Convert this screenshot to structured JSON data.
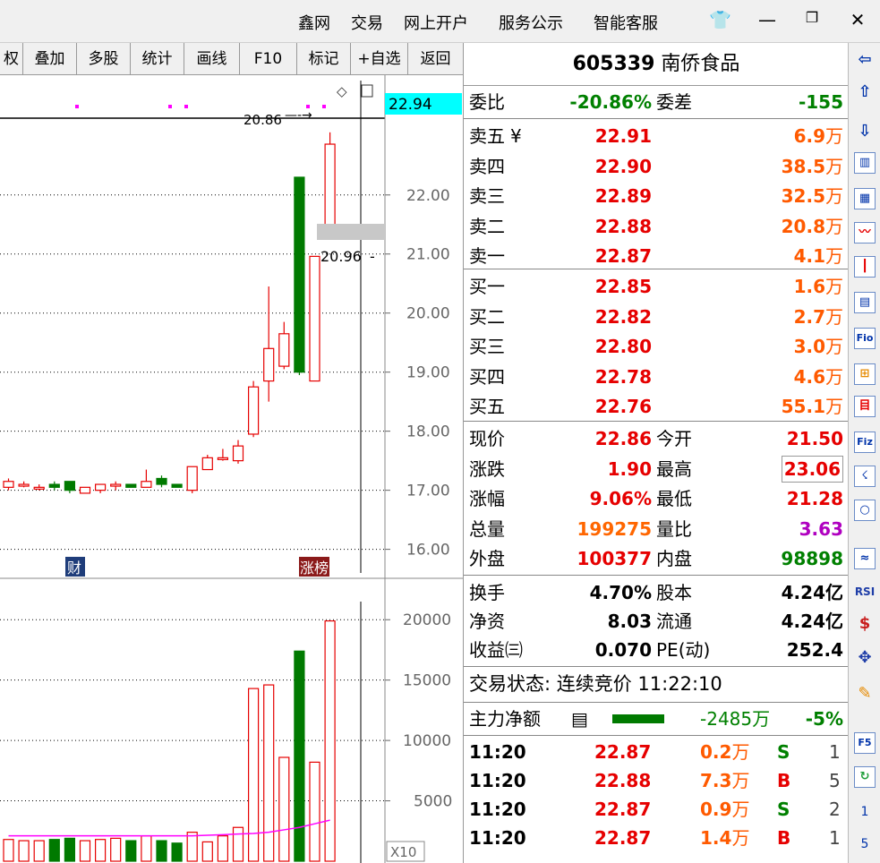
{
  "topbar": {
    "menus": [
      "鑫网",
      "交易",
      "网上开户",
      "服务公示",
      "智能客服"
    ]
  },
  "toolbar": {
    "buttons": [
      "权",
      "叠加",
      "多股",
      "统计",
      "画线",
      "F10",
      "标记",
      "+自选",
      "返回"
    ]
  },
  "chart": {
    "price_ticks": [
      "22.00",
      "21.00",
      "20.00",
      "19.00",
      "18.00",
      "17.00",
      "16.00"
    ],
    "volume_ticks": [
      "20000",
      "15000",
      "10000",
      "5000"
    ],
    "current_price_tag": "22.94",
    "annotation_high": "20.86",
    "annotation_mid": "20.96",
    "tag_cai": "财",
    "tag_zhangbang": "涨榜",
    "vol_unit": "X10"
  },
  "quote": {
    "code": "605339",
    "name": "南侨食品",
    "weibi": {
      "label": "委比",
      "value": "-20.86%",
      "label2": "委差",
      "value2": "-155"
    },
    "asks": [
      {
        "label": "卖五",
        "mark": "¥",
        "price": "22.91",
        "vol": "6.9",
        "unit": "万"
      },
      {
        "label": "卖四",
        "mark": "",
        "price": "22.90",
        "vol": "38.5",
        "unit": "万"
      },
      {
        "label": "卖三",
        "mark": "",
        "price": "22.89",
        "vol": "32.5",
        "unit": "万"
      },
      {
        "label": "卖二",
        "mark": "",
        "price": "22.88",
        "vol": "20.8",
        "unit": "万"
      },
      {
        "label": "卖一",
        "mark": "",
        "price": "22.87",
        "vol": "4.1",
        "unit": "万"
      }
    ],
    "bids": [
      {
        "label": "买一",
        "price": "22.85",
        "vol": "1.6",
        "unit": "万"
      },
      {
        "label": "买二",
        "price": "22.82",
        "vol": "2.7",
        "unit": "万"
      },
      {
        "label": "买三",
        "price": "22.80",
        "vol": "3.0",
        "unit": "万"
      },
      {
        "label": "买四",
        "price": "22.78",
        "vol": "4.6",
        "unit": "万"
      },
      {
        "label": "买五",
        "price": "22.76",
        "vol": "55.1",
        "unit": "万"
      }
    ],
    "stats": [
      {
        "l1": "现价",
        "v1": "22.86",
        "c1": "red",
        "l2": "今开",
        "v2": "21.50",
        "c2": "red"
      },
      {
        "l1": "涨跌",
        "v1": "1.90",
        "c1": "red",
        "l2": "最高",
        "v2": "23.06",
        "c2": "red"
      },
      {
        "l1": "涨幅",
        "v1": "9.06%",
        "c1": "red",
        "l2": "最低",
        "v2": "21.28",
        "c2": "red"
      },
      {
        "l1": "总量",
        "v1": "199275",
        "c1": "orange",
        "l2": "量比",
        "v2": "3.63",
        "c2": "purple"
      },
      {
        "l1": "外盘",
        "v1": "100377",
        "c1": "red",
        "l2": "内盘",
        "v2": "98898",
        "c2": "green"
      }
    ],
    "fund": [
      {
        "l1": "换手",
        "v1": "4.70%",
        "l2": "股本",
        "v2": "4.24亿"
      },
      {
        "l1": "净资",
        "v1": "8.03",
        "l2": "流通",
        "v2": "4.24亿"
      },
      {
        "l1": "收益㈢",
        "v1": "0.070",
        "l2": "PE(动)",
        "v2": "252.4"
      }
    ],
    "status": "交易状态: 连续竞价 11:22:10",
    "mainflow": {
      "label": "主力净额",
      "value": "-2485",
      "unit": "万",
      "pct": "-5%"
    },
    "trades": [
      {
        "time": "11:20",
        "price": "22.87",
        "vol": "0.2",
        "unit": "万",
        "side": "S",
        "n": "1"
      },
      {
        "time": "11:20",
        "price": "22.88",
        "vol": "7.3",
        "unit": "万",
        "side": "B",
        "n": "5"
      },
      {
        "time": "11:20",
        "price": "22.87",
        "vol": "0.9",
        "unit": "万",
        "side": "S",
        "n": "2"
      },
      {
        "time": "11:20",
        "price": "22.87",
        "vol": "1.4",
        "unit": "万",
        "side": "B",
        "n": "1"
      }
    ]
  },
  "sidebar": {
    "labels": [
      "Fio",
      "Fiz",
      "RSI",
      "F5",
      "1",
      "5"
    ]
  },
  "chart_data": {
    "type": "candlestick",
    "ylim": [
      15.6,
      23.3
    ],
    "candles": [
      {
        "o": 17.05,
        "c": 17.15,
        "h": 17.2,
        "l": 17.0
      },
      {
        "o": 17.1,
        "c": 17.1,
        "h": 17.15,
        "l": 17.05
      },
      {
        "o": 17.05,
        "c": 17.05,
        "h": 17.1,
        "l": 17.0
      },
      {
        "o": 17.1,
        "c": 17.05,
        "h": 17.15,
        "l": 17.0
      },
      {
        "o": 17.15,
        "c": 17.0,
        "h": 17.15,
        "l": 16.95
      },
      {
        "o": 16.95,
        "c": 17.05,
        "h": 17.05,
        "l": 16.95
      },
      {
        "o": 17.0,
        "c": 17.1,
        "h": 17.1,
        "l": 16.95
      },
      {
        "o": 17.1,
        "c": 17.1,
        "h": 17.15,
        "l": 17.0
      },
      {
        "o": 17.1,
        "c": 17.05,
        "h": 17.1,
        "l": 17.05
      },
      {
        "o": 17.05,
        "c": 17.15,
        "h": 17.35,
        "l": 17.05
      },
      {
        "o": 17.2,
        "c": 17.1,
        "h": 17.25,
        "l": 17.05
      },
      {
        "o": 17.1,
        "c": 17.05,
        "h": 17.1,
        "l": 17.05
      },
      {
        "o": 17.0,
        "c": 17.4,
        "h": 17.4,
        "l": 16.95
      },
      {
        "o": 17.35,
        "c": 17.55,
        "h": 17.6,
        "l": 17.35
      },
      {
        "o": 17.55,
        "c": 17.55,
        "h": 17.7,
        "l": 17.5
      },
      {
        "o": 17.5,
        "c": 17.75,
        "h": 17.85,
        "l": 17.45
      },
      {
        "o": 17.95,
        "c": 18.75,
        "h": 18.85,
        "l": 17.9
      },
      {
        "o": 18.85,
        "c": 19.4,
        "h": 20.45,
        "l": 18.5
      },
      {
        "o": 19.1,
        "c": 19.65,
        "h": 19.85,
        "l": 19.05
      },
      {
        "o": 22.3,
        "c": 19.0,
        "h": 22.3,
        "l": 18.95
      },
      {
        "o": 18.85,
        "c": 20.96,
        "h": 20.96,
        "l": 18.85
      },
      {
        "o": 21.28,
        "c": 22.86,
        "h": 23.06,
        "l": 21.28
      }
    ],
    "volumes": [
      1800,
      1700,
      1700,
      1800,
      1900,
      1700,
      1800,
      1900,
      1700,
      2100,
      1700,
      1500,
      2400,
      1600,
      2100,
      2800,
      14300,
      14600,
      8600,
      17400,
      8200,
      19900
    ],
    "vol_ma": [
      2100,
      2100,
      2100,
      2100,
      2100,
      2100,
      2100,
      2100,
      2100,
      2100,
      2100,
      2100,
      2100,
      2150,
      2200,
      2250,
      2300,
      2400,
      2600,
      2800,
      3100,
      3400
    ]
  }
}
